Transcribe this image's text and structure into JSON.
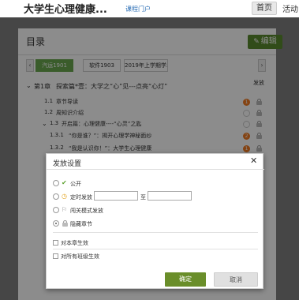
{
  "header": {
    "course_title": "大学生心理健康...",
    "portal_link": "课程门户",
    "nav": {
      "home": "首页",
      "activity": "活动"
    }
  },
  "panel": {
    "title": "目录",
    "edit_label": "编辑",
    "release_column": "发放",
    "tabs": [
      {
        "label": "汽运1901",
        "active": true
      },
      {
        "label": "软件1903",
        "active": false
      },
      {
        "label": "2019年上学期学...",
        "active": false
      }
    ],
    "tree": [
      {
        "num": "第1章",
        "label": "探索篇*壹：大学之“心”见---点亮“心灯”",
        "badge": null
      },
      {
        "num": "1.1",
        "label": "章节导读",
        "badge": "1"
      },
      {
        "num": "1.2",
        "label": "周知识介绍",
        "badge": ""
      },
      {
        "num": "1.3",
        "label": "开启篇：心理健康----“心灵”之匙",
        "badge": ""
      },
      {
        "num": "1.3.1",
        "label": "“你是谁？”：揭开心理学神秘面纱",
        "badge": "2"
      },
      {
        "num": "1.3.2",
        "label": "“我是认识你！”：大学生心理健康",
        "badge": "1"
      }
    ]
  },
  "dialog": {
    "title": "发放设置",
    "options": [
      {
        "label": "公开",
        "icon": "check-icon",
        "selected": false
      },
      {
        "label": "定时发放",
        "icon": "clock-icon",
        "selected": false
      },
      {
        "label": "闯关模式发放",
        "icon": "flag-icon",
        "selected": false
      },
      {
        "label": "隐藏章节",
        "icon": "lock-icon",
        "selected": true
      }
    ],
    "date_to": "至",
    "checks": [
      {
        "label": "对本章生效"
      },
      {
        "label": "对所有班级生效"
      }
    ],
    "ok_label": "确定",
    "cancel_label": "取消"
  }
}
